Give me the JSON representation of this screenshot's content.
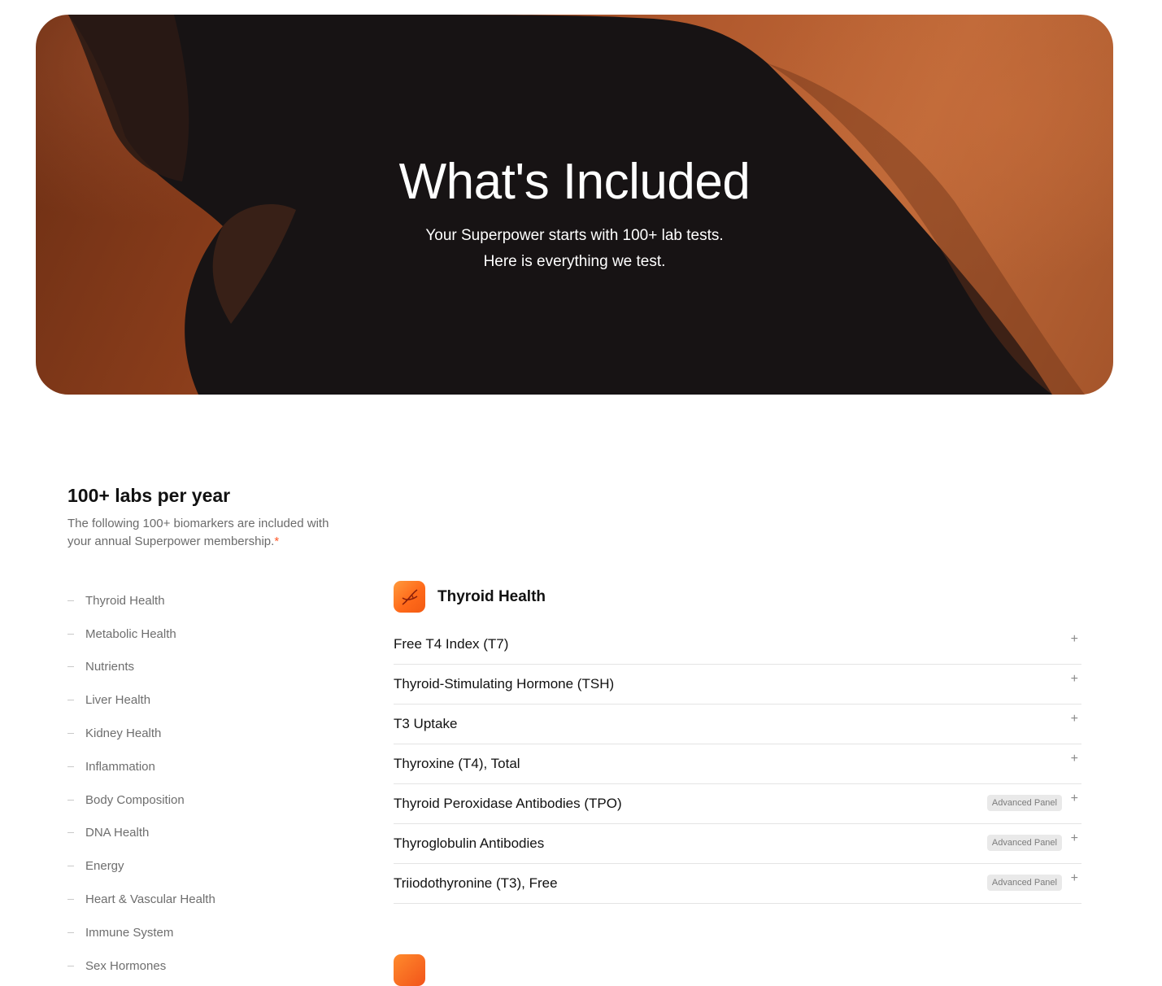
{
  "hero": {
    "title": "What's Included",
    "subtitle_line1": "Your Superpower starts with 100+ lab tests.",
    "subtitle_line2": "Here is everything we test."
  },
  "section": {
    "title": "100+ labs per year",
    "description": "The following 100+ biomarkers are included with your annual Superpower membership.",
    "asterisk": "*"
  },
  "categories": [
    "Thyroid Health",
    "Metabolic Health",
    "Nutrients",
    "Liver Health",
    "Kidney Health",
    "Inflammation",
    "Body Composition",
    "DNA Health",
    "Energy",
    "Heart & Vascular Health",
    "Immune System",
    "Sex Hormones"
  ],
  "panel": {
    "title": "Thyroid Health",
    "icon": "dna-icon",
    "biomarkers": [
      {
        "name": "Free T4 Index (T7)",
        "badge": ""
      },
      {
        "name": "Thyroid-Stimulating Hormone (TSH)",
        "badge": ""
      },
      {
        "name": "T3 Uptake",
        "badge": ""
      },
      {
        "name": "Thyroxine (T4), Total",
        "badge": ""
      },
      {
        "name": "Thyroid Peroxidase Antibodies (TPO)",
        "badge": "Advanced Panel"
      },
      {
        "name": "Thyroglobulin Antibodies",
        "badge": "Advanced Panel"
      },
      {
        "name": "Triiodothyronine (T3), Free",
        "badge": "Advanced Panel"
      }
    ],
    "expand_symbol": "+"
  },
  "colors": {
    "accent": "#ff5a2a",
    "hero_bg": "#b25a2e",
    "badge_bg": "#e9e9e9"
  }
}
